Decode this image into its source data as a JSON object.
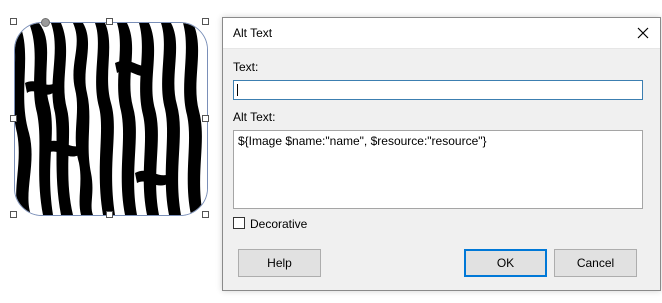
{
  "dialog": {
    "title": "Alt Text",
    "text_label": "Text:",
    "text_value": "",
    "alt_text_label": "Alt Text:",
    "alt_text_value": "${Image $name:\"name\", $resource:\"resource\"}",
    "decorative_label": "Decorative",
    "decorative_checked": false,
    "help_label": "Help",
    "ok_label": "OK",
    "cancel_label": "Cancel"
  },
  "icons": {
    "close": "close-icon"
  },
  "colors": {
    "focus_border": "#3c7fb1",
    "primary_button_border": "#0078d7",
    "dialog_background": "#f0f0f0"
  }
}
